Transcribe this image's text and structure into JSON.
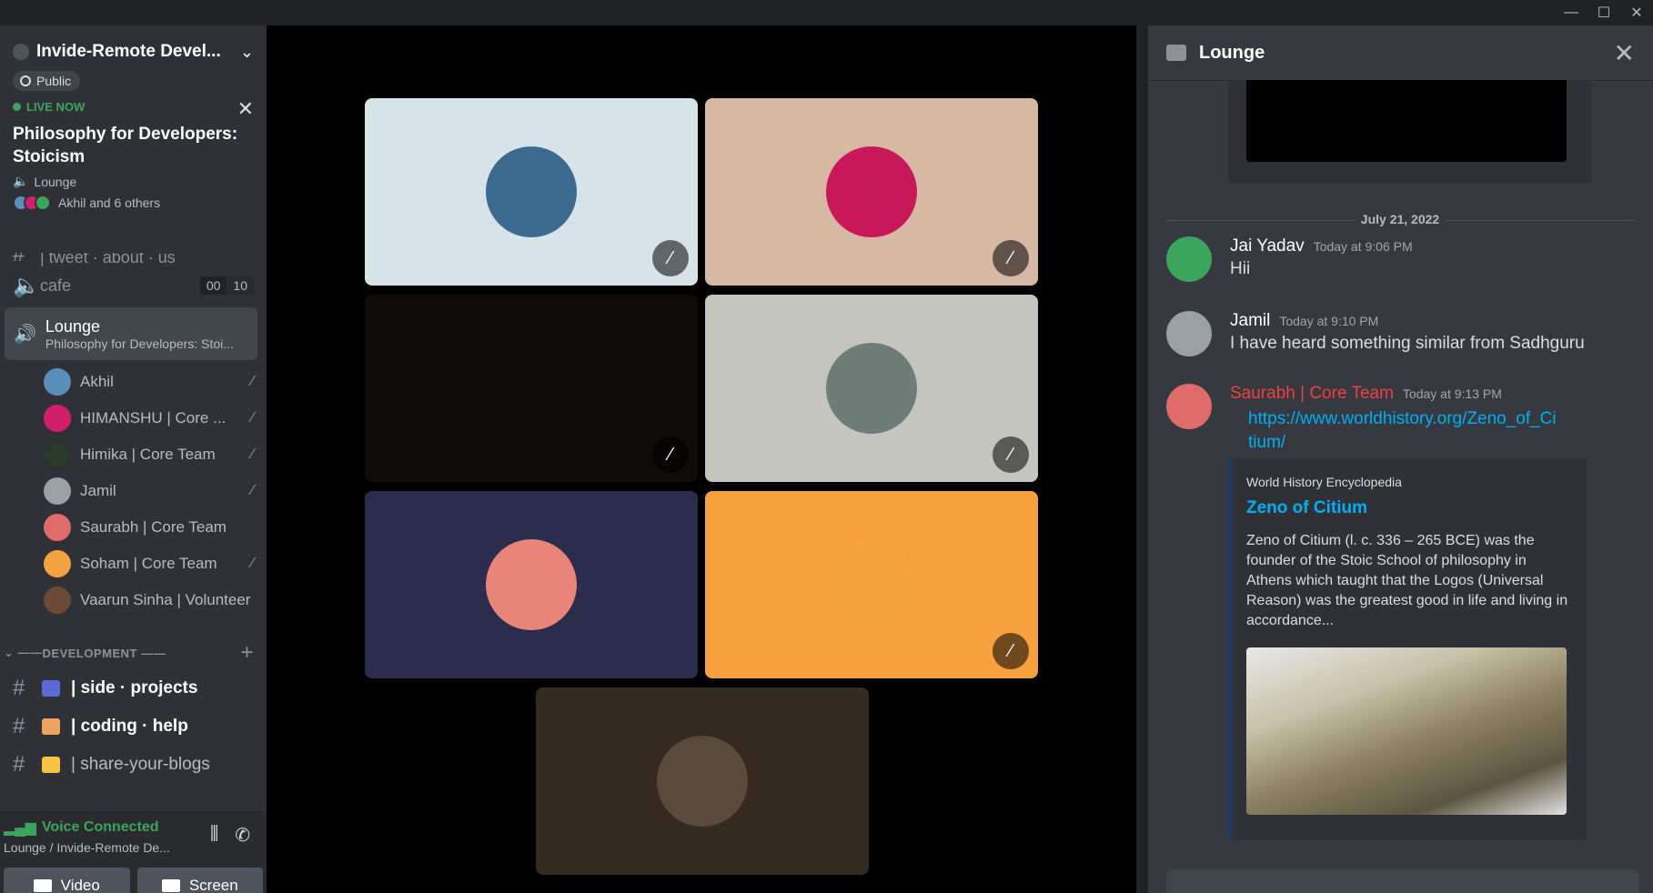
{
  "window": {
    "controls": [
      "—",
      "☐",
      "✕"
    ]
  },
  "server": {
    "name": "Invide-Remote Devel...",
    "visibility": "Public",
    "live_label": "LIVE NOW",
    "event_title": "Philosophy for Developers: Stoicism",
    "event_channel": "Lounge",
    "event_people": "Akhil and 6 others"
  },
  "channels": {
    "partial": "| tweet · about · us",
    "cafe": {
      "name": "cafe",
      "count_a": "00",
      "count_b": "10"
    },
    "lounge": {
      "name": "Lounge",
      "topic": "Philosophy for Developers: Stoi..."
    },
    "members": [
      {
        "name": "Akhil",
        "color": "#5b8fb9"
      },
      {
        "name": "HIMANSHU | Core ...",
        "color": "#d21f6b"
      },
      {
        "name": "Himika | Core Team",
        "color": "#2a3a2a"
      },
      {
        "name": "Jamil",
        "color": "#9aa0a6"
      },
      {
        "name": "Saurabh | Core Team",
        "color": "#e06b6b"
      },
      {
        "name": "Soham | Core Team",
        "color": "#f4a340"
      },
      {
        "name": "Vaarun Sinha | Volunteer",
        "color": "#6b4a35"
      }
    ],
    "category": "DEVELOPMENT",
    "text_channels": [
      {
        "emoji_color": "#5b6bd6",
        "name": "| side · projects"
      },
      {
        "emoji_color": "#f0a35e",
        "name": "| coding · help"
      },
      {
        "emoji_color": "#f5c542",
        "name": "| share-your-blogs"
      }
    ]
  },
  "voice": {
    "status": "Voice Connected",
    "location": "Lounge / Invide-Remote De...",
    "video_label": "Video",
    "screen_label": "Screen"
  },
  "stage_tiles": [
    {
      "bg": "#d6e4ea",
      "pfp": "#3d6b8f",
      "muted": true
    },
    {
      "bg": "#d6b8a3",
      "pfp": "#c8185a",
      "muted": true
    },
    {
      "bg": "#0e0b08",
      "pfp": "#0e0b08",
      "muted": true
    },
    {
      "bg": "#c5c5c0",
      "pfp": "#6f7d78",
      "muted": true
    },
    {
      "bg": "#2c2c4c",
      "pfp": "#e8847a",
      "muted": false
    },
    {
      "bg": "#f6a040",
      "pfp": "#f4a340",
      "muted": true
    },
    {
      "bg": "#352a20",
      "pfp": "#5a4a3a",
      "muted": false
    }
  ],
  "chat": {
    "title": "Lounge",
    "date": "July 21, 2022",
    "messages": [
      {
        "author": "Jai Yadav",
        "time": "Today at 9:06 PM",
        "text": "Hii",
        "av": "#3ba55d",
        "author_color": "#ffffff"
      },
      {
        "author": "Jamil",
        "time": "Today at 9:10 PM",
        "text": "I have heard something similar from Sadhguru",
        "av": "#9aa0a6",
        "author_color": "#ffffff"
      },
      {
        "author": "Saurabh | Core Team",
        "time": "Today at 9:13 PM",
        "link": "https://www.worldhistory.org/Zeno_of_Citium/",
        "av": "#e06b6b",
        "author_color": "#ed4245"
      }
    ],
    "embed": {
      "provider": "World History Encyclopedia",
      "title": "Zeno of Citium",
      "description": "Zeno of Citium (l. c. 336 – 265 BCE) was the founder of the Stoic School of philosophy in Athens which taught that the Logos (Universal Reason) was the greatest good in life and living in accordance..."
    }
  }
}
